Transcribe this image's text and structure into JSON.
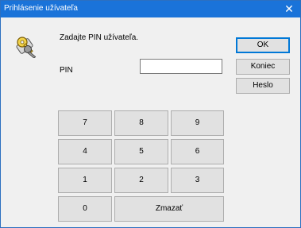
{
  "window": {
    "title": "Prihlásenie užívateľa",
    "close_glyph": "✕"
  },
  "dialog": {
    "icon": "keys-icon",
    "prompt": "Zadajte PIN užívateľa.",
    "pin_label": "PIN",
    "pin_value": ""
  },
  "buttons": {
    "ok": "OK",
    "exit": "Koniec",
    "password": "Heslo"
  },
  "keypad": {
    "k7": "7",
    "k8": "8",
    "k9": "9",
    "k4": "4",
    "k5": "5",
    "k6": "6",
    "k1": "1",
    "k2": "2",
    "k3": "3",
    "k0": "0",
    "clear": "Zmazať"
  },
  "colors": {
    "titlebar": "#1a73d9",
    "dialog_bg": "#f0f0f0",
    "button_bg": "#e1e1e1",
    "default_border": "#0078d7"
  }
}
